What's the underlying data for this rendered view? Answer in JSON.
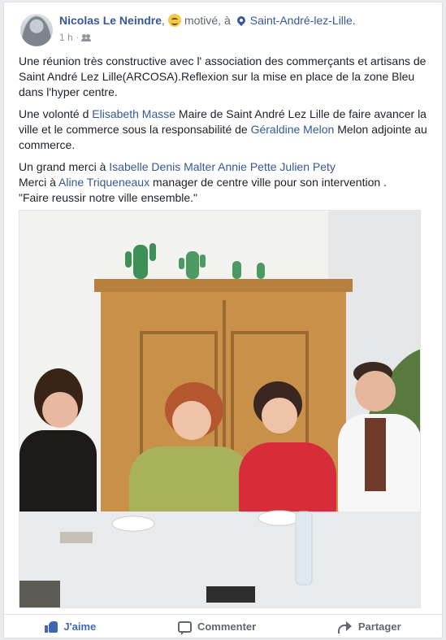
{
  "post": {
    "author": "Nicolas Le Neindre",
    "feeling_prefix": ",",
    "feeling": "motivé, à",
    "location": "Saint-André-lez-Lille.",
    "time": "1 h",
    "separator": "·"
  },
  "body": {
    "p1": "Une réunion très constructive avec l' association des commerçants et artisans de Saint André Lez Lille(ARCOSA).Reflexion sur la mise en place de la zone Bleu dans l'hyper centre.",
    "p2_a": "Une volonté d ",
    "p2_tag1": "Elisabeth Masse",
    "p2_b": " Maire de Saint André Lez Lille de faire avancer la ville et le commerce sous la responsabilité de ",
    "p2_tag2": "Géraldine Melon",
    "p2_c": " Melon adjointe au commerce.",
    "p3_a": "Un grand merci à ",
    "p3_tag1": "Isabelle Denis Malter",
    "p3_sep1": " ",
    "p3_tag2": "Annie Pette",
    "p3_sep2": " ",
    "p3_tag3": "Julien Pety",
    "p3_b": "Merci à ",
    "p3_tag4": "Aline Triqueneaux",
    "p3_c": " manager de centre ville pour son intervention .",
    "p3_d": "\"Faire reussir notre ville ensemble.\""
  },
  "actions": {
    "like": "J'aime",
    "comment": "Commenter",
    "share": "Partager"
  },
  "colors": {
    "link": "#365899",
    "like_active": "#4267b2",
    "muted": "#616770"
  }
}
